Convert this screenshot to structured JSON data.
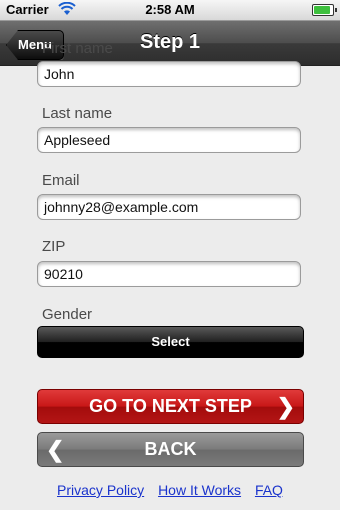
{
  "status_bar": {
    "carrier": "Carrier",
    "time": "2:58 AM",
    "battery_level": 0.9,
    "wifi_icon": "wifi-icon",
    "battery_icon": "battery-icon"
  },
  "nav": {
    "back_label": "Menu",
    "title": "Step 1"
  },
  "form": {
    "first_name": {
      "label": "First name",
      "value": "John"
    },
    "last_name": {
      "label": "Last name",
      "value": "Appleseed"
    },
    "email": {
      "label": "Email",
      "value": "johnny28@example.com"
    },
    "zip": {
      "label": "ZIP",
      "value": "90210"
    },
    "gender": {
      "label": "Gender",
      "select_label": "Select"
    }
  },
  "actions": {
    "next_label": "GO TO NEXT STEP",
    "next_icon": "chevron-right-icon",
    "back_label": "BACK",
    "back_icon": "chevron-left-icon"
  },
  "footer": {
    "links": [
      "Privacy Policy",
      "How It Works",
      "FAQ"
    ]
  },
  "colors": {
    "accent_red": "#c81717",
    "link_blue": "#1a33cc"
  }
}
